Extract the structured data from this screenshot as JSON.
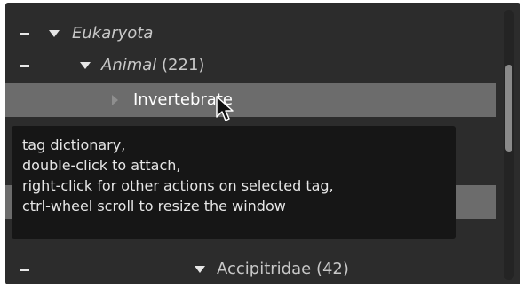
{
  "tree": {
    "rows": [
      {
        "label": "Eukaryota",
        "count": ""
      },
      {
        "label": "Animal",
        "count": "(221)"
      },
      {
        "label": "Invertebrate",
        "count": ""
      },
      {
        "label": "Accipitridae",
        "count": "(42)"
      }
    ]
  },
  "tooltip": {
    "lines": [
      "tag dictionary,",
      "double-click to attach,",
      "right-click for other actions on selected tag,",
      "ctrl-wheel scroll to resize the window"
    ]
  },
  "scrollbar": {
    "position_fraction": 0.2
  },
  "colors": {
    "panel_bg": "#2c2c2c",
    "selected_row": "#6c6c6c",
    "tooltip_bg": "#161616"
  }
}
